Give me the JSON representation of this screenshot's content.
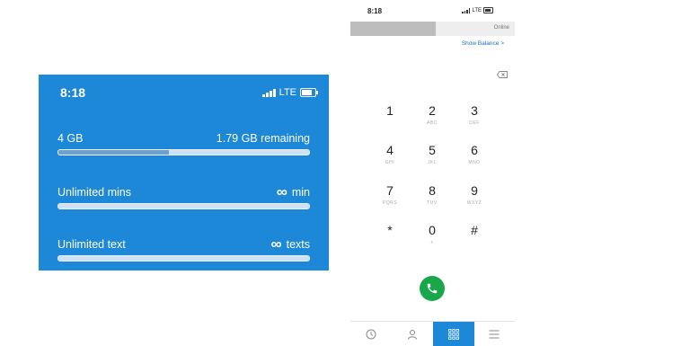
{
  "usage_card": {
    "time": "8:18",
    "network": "LTE",
    "rows": [
      {
        "label": "4 GB",
        "value": "1.79 GB remaining",
        "fill_fraction": 0.44
      },
      {
        "label": "Unlimited mins",
        "symbol": "∞",
        "value": "min",
        "fill_fraction": 1.0
      },
      {
        "label": "Unlimited text",
        "symbol": "∞",
        "value": "texts",
        "fill_fraction": 1.0
      }
    ]
  },
  "phone": {
    "time": "8:18",
    "network": "LTE",
    "account_status": "Online",
    "show_balance": "Show Balance >",
    "keys": [
      {
        "digit": "1",
        "letters": ""
      },
      {
        "digit": "2",
        "letters": "ABC"
      },
      {
        "digit": "3",
        "letters": "DEF"
      },
      {
        "digit": "4",
        "letters": "GHI"
      },
      {
        "digit": "5",
        "letters": "JKL"
      },
      {
        "digit": "6",
        "letters": "MNO"
      },
      {
        "digit": "7",
        "letters": "PQRS"
      },
      {
        "digit": "8",
        "letters": "TUV"
      },
      {
        "digit": "9",
        "letters": "WXYZ"
      },
      {
        "digit": "*",
        "letters": ""
      },
      {
        "digit": "0",
        "letters": "+"
      },
      {
        "digit": "#",
        "letters": ""
      }
    ],
    "tabs": [
      {
        "icon": "clock-icon",
        "active": false
      },
      {
        "icon": "person-icon",
        "active": false
      },
      {
        "icon": "keypad-icon",
        "active": true
      },
      {
        "icon": "menu-icon",
        "active": false
      }
    ]
  },
  "colors": {
    "card_blue": "#1e88d8",
    "call_green": "#18a84a",
    "link_blue": "#1e6ec9"
  }
}
